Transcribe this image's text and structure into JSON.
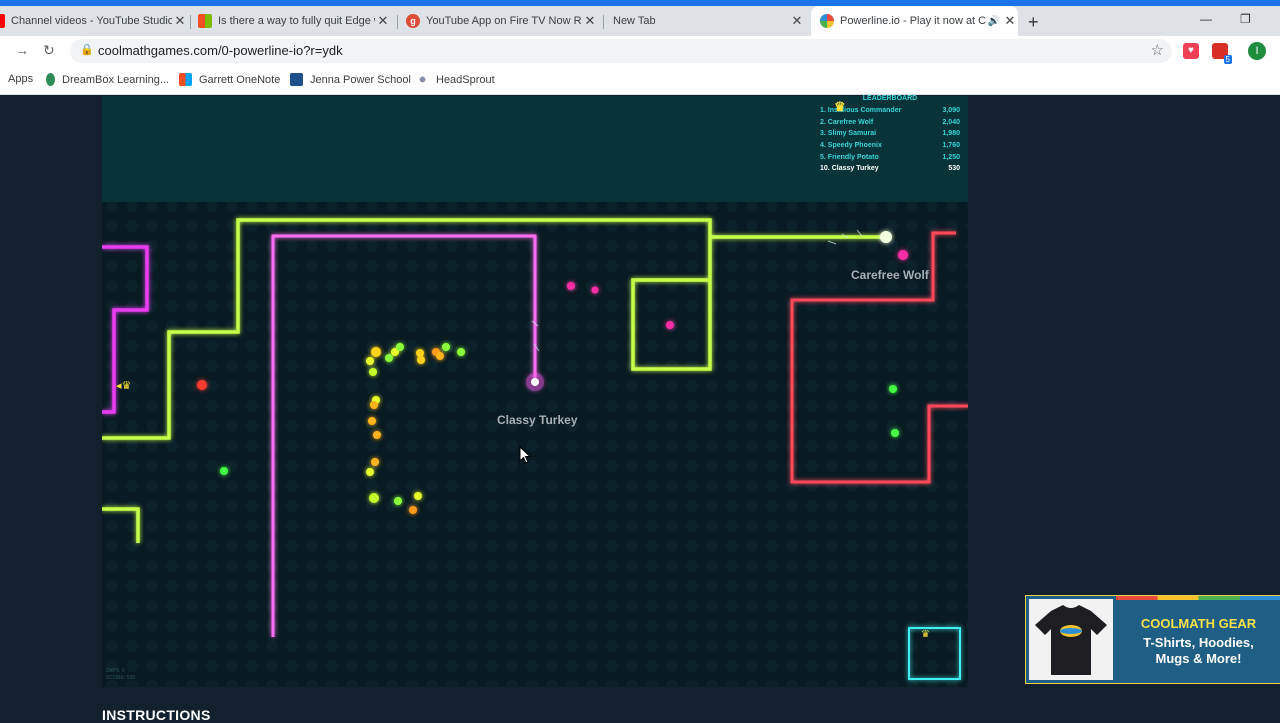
{
  "browser": {
    "tabs": [
      {
        "title": "Channel videos - YouTube Studio",
        "icon": "youtube-icon"
      },
      {
        "title": "Is there a way to fully quit Edge w",
        "icon": "microsoft-icon"
      },
      {
        "title": "YouTube App on Fire TV Now Re",
        "icon": "google-plus-icon"
      },
      {
        "title": "New Tab",
        "icon": ""
      },
      {
        "title": "Powerline.io - Play it now at C",
        "icon": "coolmath-icon"
      }
    ],
    "url": "coolmathgames.com/0-powerline-io?r=ydk",
    "bookmarks": [
      "Apps",
      "DreamBox Learning...",
      "Garrett OneNote",
      "Jenna Power School",
      "HeadSprout"
    ],
    "profile_initial": "I",
    "ext_badge": "5"
  },
  "game": {
    "leaderboard_title": "LEADERBOARD",
    "leaderboard": [
      {
        "rank": "1.",
        "name": "Insidious Commander",
        "score": "3,090"
      },
      {
        "rank": "2.",
        "name": "Carefree Wolf",
        "score": "2,040"
      },
      {
        "rank": "3.",
        "name": "Slimy Samurai",
        "score": "1,980"
      },
      {
        "rank": "4.",
        "name": "Speedy Phoenix",
        "score": "1,760"
      },
      {
        "rank": "5.",
        "name": "Friendly Potato",
        "score": "1,250"
      },
      {
        "rank": "10.",
        "name": "Classy Turkey",
        "score": "530"
      }
    ],
    "players": {
      "self": "Classy Turkey",
      "other": "Carefree Wolf"
    },
    "stats": {
      "line1": "ZAPS: 0",
      "line2": "SCORE: 530"
    }
  },
  "page": {
    "instructions_heading": "INSTRUCTIONS"
  },
  "ad": {
    "heading": "COOLMATH GEAR",
    "line1": "T-Shirts, Hoodies,",
    "line2": "Mugs & More!"
  },
  "colors": {
    "browser_accent": "#1a73e8",
    "game_bg": "#081a22",
    "snake_green": "#c6ff4a",
    "snake_pink": "#ff6ef2",
    "snake_red": "#ff4a5a",
    "snake_magenta": "#e83cf0",
    "border_cyan": "#7ee8ff"
  }
}
